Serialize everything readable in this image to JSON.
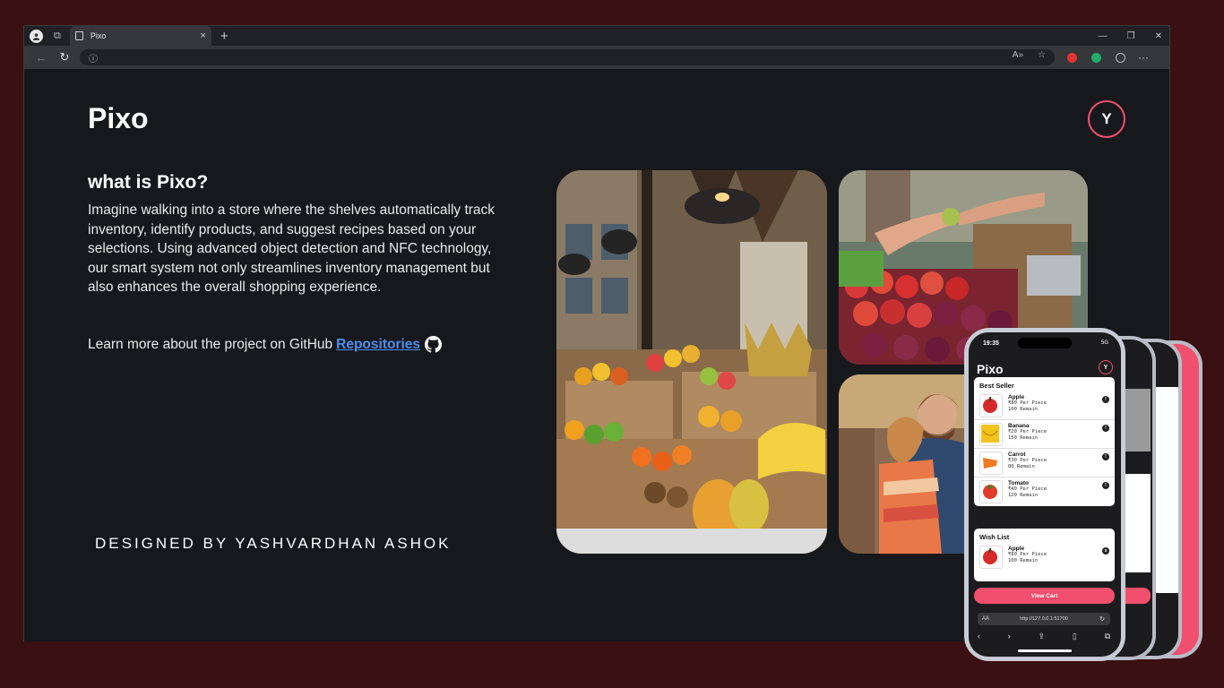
{
  "browser": {
    "tab_title": "Pixo",
    "tab_close": "×",
    "new_tab": "+",
    "window_controls": [
      "—",
      "❐",
      "✕"
    ],
    "menu": "···",
    "read_aloud": "A»",
    "favorite": "☆"
  },
  "page": {
    "logo": "Pixo",
    "avatar_letter": "Y",
    "heading": "what is Pixo?",
    "description": "Imagine walking into a store where the shelves automatically track inventory, identify products, and suggest recipes based on your selections. Using advanced object detection and NFC technology, our smart system not only streamlines inventory management but also enhances the overall shopping experience.",
    "learn_text": "Learn more about the project on GitHub",
    "learn_link": "Repositories",
    "credit": "DESIGNED BY YASHVARDHAN ASHOK"
  },
  "phone": {
    "time": "19:35",
    "signal": "5G",
    "logo": "Pixo",
    "avatar_letter": "Y",
    "best_seller_title": "Best Seller",
    "best_seller": [
      {
        "name": "Apple",
        "price": "₹80 Per Piece",
        "remain": "100 Remain",
        "color": "#d62a2a"
      },
      {
        "name": "Banana",
        "price": "₹20 Per Piece",
        "remain": "150 Remain",
        "color": "#f2c318"
      },
      {
        "name": "Carrot",
        "price": "₹30 Per Piece",
        "remain": "80 Remain",
        "color": "#f07a22"
      },
      {
        "name": "Tomato",
        "price": "₹40 Per Piece",
        "remain": "120 Remain",
        "color": "#e23b2b"
      }
    ],
    "wish_list_title": "Wish List",
    "wish_list": [
      {
        "name": "Apple",
        "price": "₹80 Per Piece",
        "remain": "100 Remain",
        "color": "#d62a2a"
      }
    ],
    "view_cart": "View Cart",
    "url_aa": "AA",
    "url": "http://127.0.0.1:51700"
  },
  "colors": {
    "accent": "#f0506e",
    "link": "#4b8ff0",
    "page_bg": "#17181c",
    "outer_bg": "#3a1012"
  }
}
